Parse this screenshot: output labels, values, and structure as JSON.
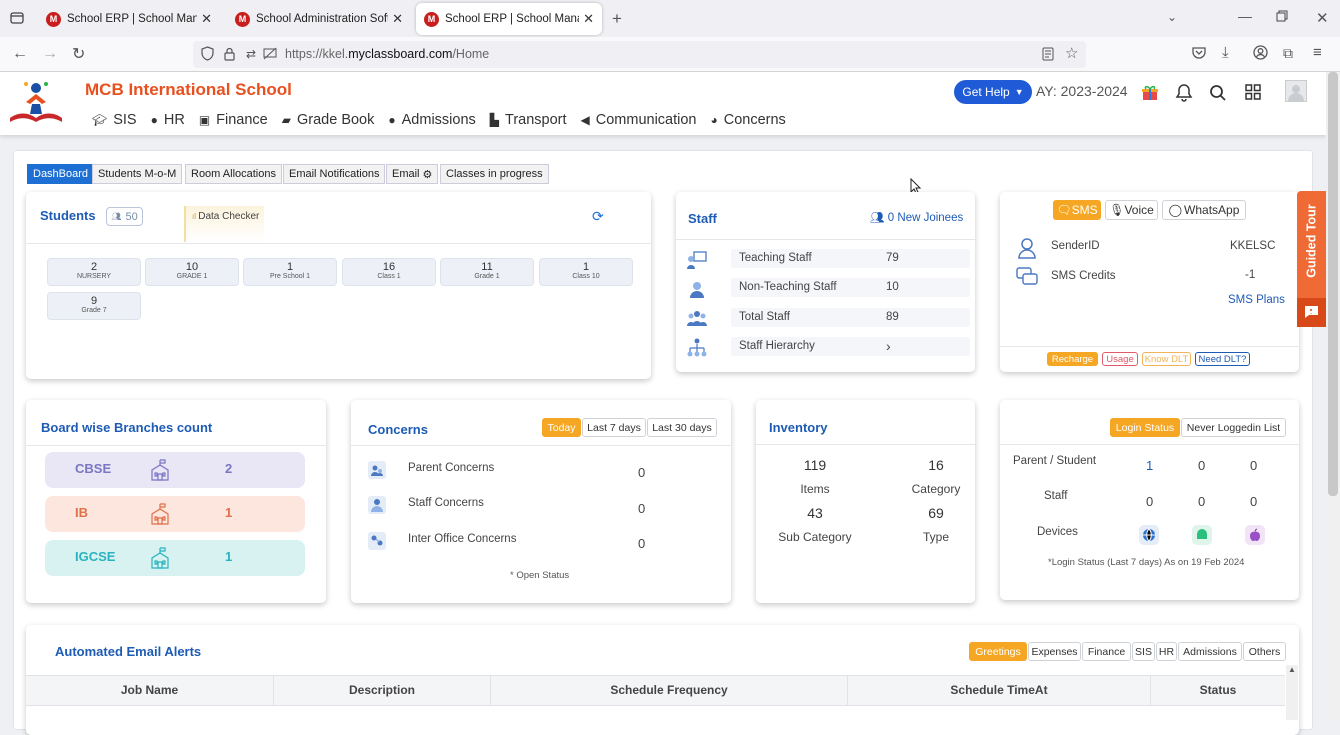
{
  "browser": {
    "tabs": [
      {
        "title": "School ERP | School Manageme",
        "favicon": "M",
        "active": false
      },
      {
        "title": "School Administration Software",
        "favicon": "M",
        "active": false
      },
      {
        "title": "School ERP | School Manageme",
        "favicon": "M",
        "active": true
      }
    ],
    "url_prefix": "https://kkel.",
    "url_domain": "myclassboard.com",
    "url_path": "/Home"
  },
  "header": {
    "school_name": "MCB International School",
    "nav": [
      "SIS",
      "HR",
      "Finance",
      "Grade Book",
      "Admissions",
      "Transport",
      "Communication",
      "Concerns"
    ],
    "get_help": "Get Help",
    "academic_year": "AY: 2023-2024"
  },
  "subtabs": [
    "DashBoard",
    "Students M-o-M",
    "Room Allocations",
    "Email Notifications",
    "Email",
    "Classes in progress"
  ],
  "students": {
    "title": "Students",
    "count": "50",
    "data_checker": "Data Checker",
    "grades": [
      {
        "n": "2",
        "l": "NURSERY"
      },
      {
        "n": "10",
        "l": "GRADE 1"
      },
      {
        "n": "1",
        "l": "Pre School 1"
      },
      {
        "n": "16",
        "l": "Class 1"
      },
      {
        "n": "11",
        "l": "Grade 1"
      },
      {
        "n": "1",
        "l": "Class 10"
      },
      {
        "n": "9",
        "l": "Grade 7"
      }
    ]
  },
  "staff": {
    "title": "Staff",
    "new_joinees": "0 New Joinees",
    "rows": [
      {
        "label": "Teaching Staff",
        "value": "79"
      },
      {
        "label": "Non-Teaching Staff",
        "value": "10"
      },
      {
        "label": "Total Staff",
        "value": "89"
      },
      {
        "label": "Staff Hierarchy",
        "value": ""
      }
    ]
  },
  "sms": {
    "tabs": [
      "SMS",
      "Voice",
      "WhatsApp"
    ],
    "sender_label": "SenderID",
    "sender_value": "KKELSC",
    "credits_label": "SMS Credits",
    "credits_value": "-1",
    "plans": "SMS Plans",
    "tags": [
      "Recharge",
      "Usage",
      "Know DLT",
      "Need DLT?"
    ]
  },
  "guided_tour": "Guided Tour",
  "boards": {
    "title": "Board wise Branches count",
    "items": [
      {
        "name": "CBSE",
        "count": "2",
        "color": "#7b76c4",
        "bg": "#e9e6f6"
      },
      {
        "name": "IB",
        "count": "1",
        "color": "#e0704a",
        "bg": "#fde6de"
      },
      {
        "name": "IGCSE",
        "count": "1",
        "color": "#2ab3bd",
        "bg": "#d8f2f2"
      }
    ]
  },
  "concerns": {
    "title": "Concerns",
    "filters": [
      "Today",
      "Last 7 days",
      "Last 30 days"
    ],
    "rows": [
      {
        "label": "Parent Concerns",
        "value": "0"
      },
      {
        "label": "Staff Concerns",
        "value": "0"
      },
      {
        "label": "Inter Office Concerns",
        "value": "0"
      }
    ],
    "note": "* Open Status"
  },
  "inventory": {
    "title": "Inventory",
    "items": [
      {
        "value": "119",
        "label": "Items"
      },
      {
        "value": "16",
        "label": "Category"
      },
      {
        "value": "43",
        "label": "Sub Category"
      },
      {
        "value": "69",
        "label": "Type"
      }
    ]
  },
  "login": {
    "filters": [
      "Login Status",
      "Never Loggedin List"
    ],
    "rows": [
      {
        "label": "Parent / Student",
        "v1": "1",
        "v2": "0",
        "v3": "0"
      },
      {
        "label": "Staff",
        "v1": "0",
        "v2": "0",
        "v3": "0"
      }
    ],
    "devices_label": "Devices",
    "note": "*Login Status (Last 7 days) As on 19 Feb 2024"
  },
  "email_alerts": {
    "title": "Automated Email Alerts",
    "filters": [
      "Greetings",
      "Expenses",
      "Finance",
      "SIS",
      "HR",
      "Admissions",
      "Others"
    ],
    "columns": [
      "Job Name",
      "Description",
      "Schedule Frequency",
      "Schedule TimeAt",
      "Status"
    ]
  },
  "colors": {
    "accent": "#1e5bb5",
    "orange": "#f5a623",
    "brand": "#e8501f"
  }
}
